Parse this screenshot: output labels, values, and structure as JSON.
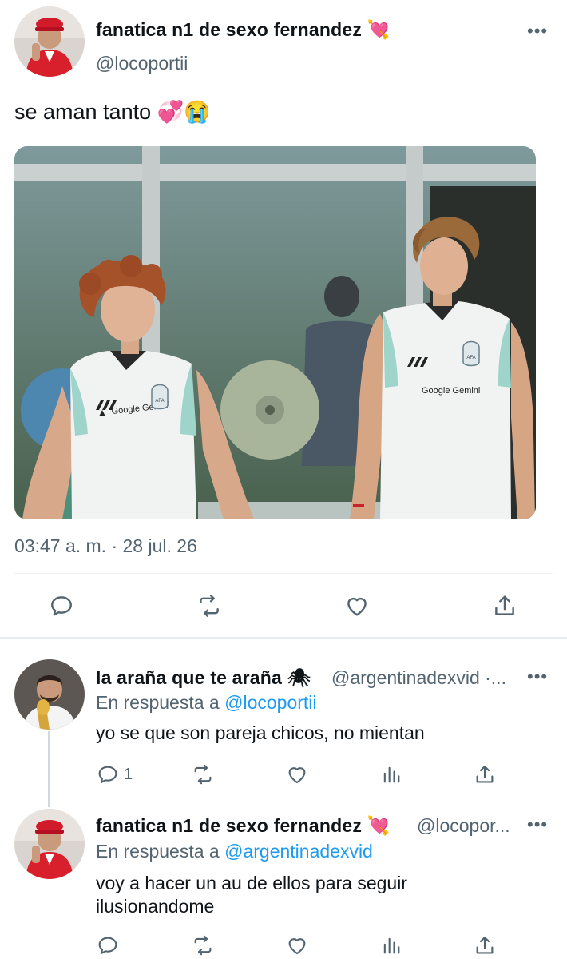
{
  "colors": {
    "accent": "#1d9bf0",
    "secondary": "#536471",
    "text": "#0f1419",
    "divider": "#eff3f4"
  },
  "main_tweet": {
    "author_name": "fanatica n1 de sexo fernandez 💘",
    "handle": "@locoportii",
    "more": "•••",
    "text": "se aman tanto 💞😭",
    "image_texts": {
      "sponsor_left": "Google Gemini",
      "sponsor_right": "Google Gemini",
      "crest": "AFA"
    },
    "timestamp": "03:47 a. m. · 28 jul. 26",
    "actions": [
      "reply-icon",
      "retweet-icon",
      "like-icon",
      "share-icon"
    ]
  },
  "replies": [
    {
      "author_name": "la araña que te araña 🕷",
      "handle": "@argentinadexvid ·...",
      "more": "•••",
      "reply_prefix": "En respuesta a",
      "reply_handle": "@locoportii",
      "text": "yo se que son pareja chicos, no mientan",
      "reply_count": "1",
      "actions": [
        "reply-icon",
        "retweet-icon",
        "like-icon",
        "views-icon",
        "share-icon"
      ]
    },
    {
      "author_name": "fanatica n1 de sexo fernandez 💘",
      "handle": "@locopor...",
      "more": "•••",
      "reply_prefix": "En respuesta a",
      "reply_handle": "@argentinadexvid",
      "text_line1": "voy a hacer un au de ellos para seguir",
      "text_line2": "ilusionandome",
      "actions": [
        "reply-icon",
        "retweet-icon",
        "like-icon",
        "views-icon",
        "share-icon"
      ]
    }
  ]
}
